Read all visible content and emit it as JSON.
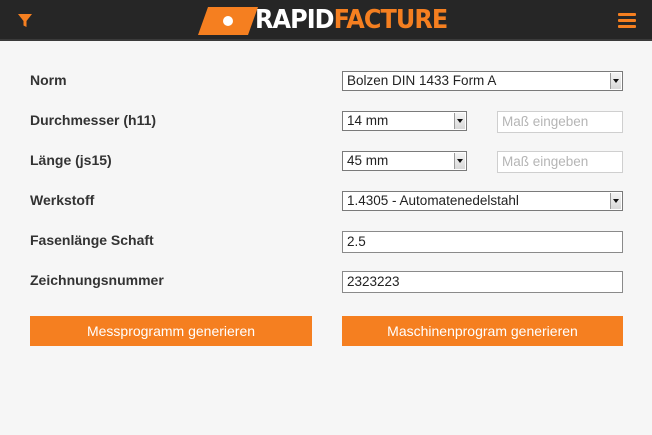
{
  "header": {
    "logo_primary": "RAPID",
    "logo_secondary": "FACTURE",
    "filter_icon": "filter-icon",
    "menu_icon": "hamburger-menu-icon",
    "accent_color": "#f57f20",
    "bar_color": "#262626"
  },
  "form": {
    "norm": {
      "label": "Norm",
      "value": "Bolzen DIN 1433 Form A"
    },
    "durchmesser": {
      "label": "Durchmesser (h11)",
      "value": "14 mm",
      "custom_placeholder": "Maß eingeben"
    },
    "laenge": {
      "label": "Länge (js15)",
      "value": "45 mm",
      "custom_placeholder": "Maß eingeben"
    },
    "werkstoff": {
      "label": "Werkstoff",
      "value": "1.4305 - Automatenedelstahl"
    },
    "fasenlaenge": {
      "label": "Fasenlänge Schaft",
      "value": "2.5"
    },
    "zeichnungsnummer": {
      "label": "Zeichnungsnummer",
      "value": "2323223"
    }
  },
  "actions": {
    "messprogramm": "Messprogramm generieren",
    "maschinenprogram": "Maschinenprogram generieren"
  }
}
